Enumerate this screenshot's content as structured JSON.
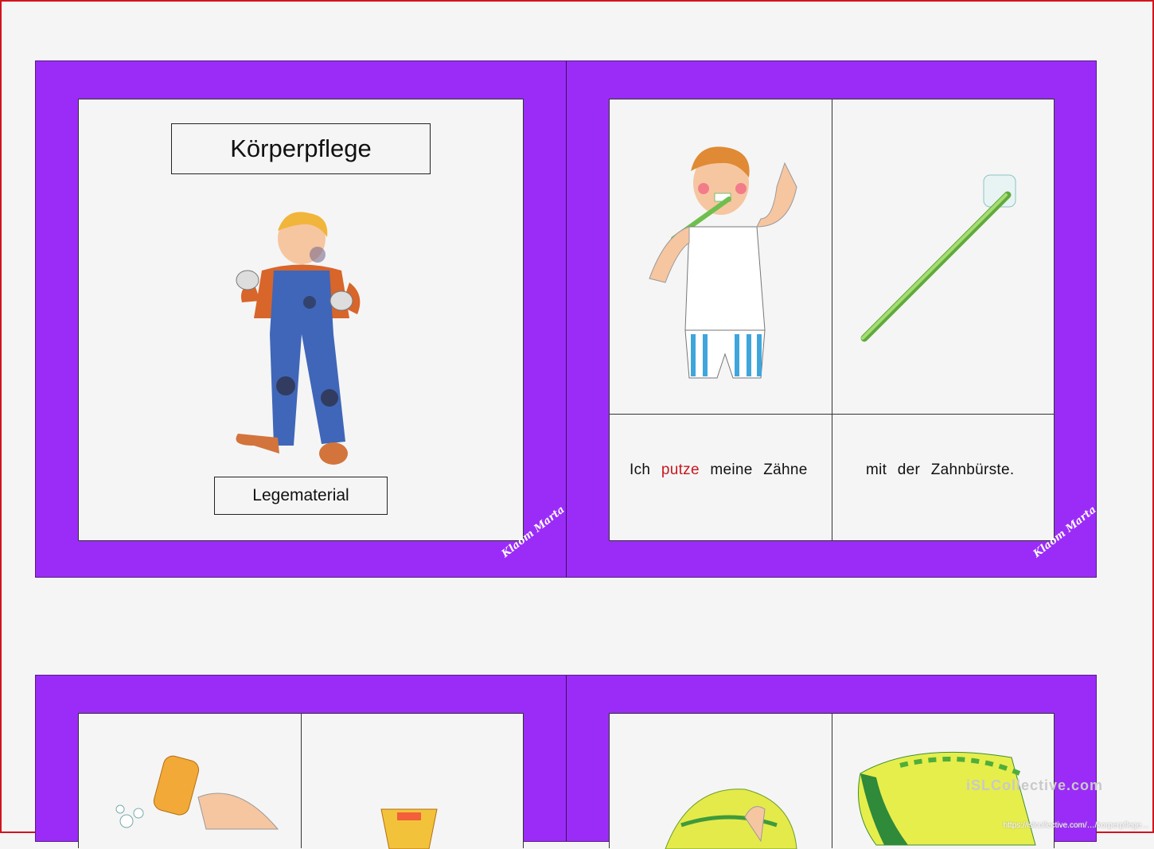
{
  "cover_card": {
    "title": "Körperpflege",
    "subtitle": "Legematerial",
    "signature": "Klaom Marta"
  },
  "card_brushing": {
    "sentence_parts": [
      "Ich",
      "putze",
      "meine Zähne"
    ],
    "sentence_right": "mit der Zahnbürste.",
    "signature": "Klaom Marta",
    "image_left": "boy-brushing-teeth",
    "image_right": "toothbrush"
  },
  "bottom_row": {
    "image_1": "hands-washing-with-soap-bottle",
    "image_2": "bowl",
    "image_3": "boy-with-towel",
    "image_4": "towel"
  },
  "watermark": "iSLCollective.com",
  "footer_url": "https://islcollective.com/…/korperpflege…",
  "colors": {
    "card_border": "#9b2cf7",
    "highlight_verb": "#c8181e",
    "page_frame": "#d3141c"
  }
}
